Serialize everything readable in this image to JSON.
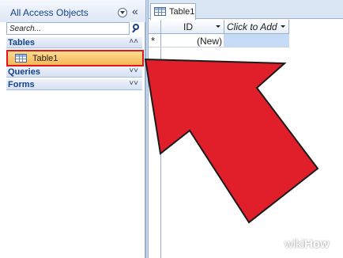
{
  "nav_pane": {
    "title": "All Access Objects",
    "search_placeholder": "Search...",
    "groups": [
      {
        "label": "Tables",
        "chevron": "˄˄",
        "expanded": true
      },
      {
        "label": "Queries",
        "chevron": "˅˅",
        "expanded": false
      },
      {
        "label": "Forms",
        "chevron": "˅˅",
        "expanded": false
      }
    ],
    "selected_item": {
      "label": "Table1",
      "icon": "table-icon"
    },
    "collapse_glyph": "«"
  },
  "document": {
    "tab_label": "Table1",
    "columns": [
      {
        "label": "ID"
      },
      {
        "label": "Click to Add"
      }
    ],
    "new_row": {
      "selector_glyph": "*",
      "id_value": "(New)"
    }
  },
  "annotation": {
    "type": "arrow",
    "color": "#e01f2a",
    "points_to": "Table1"
  },
  "watermark": {
    "part1": "wiki",
    "part2": "How"
  },
  "colors": {
    "accent": "#15428b",
    "selection": "#f8b659",
    "selection_border": "#e0161f",
    "new_cell": "#c5dbf6"
  }
}
